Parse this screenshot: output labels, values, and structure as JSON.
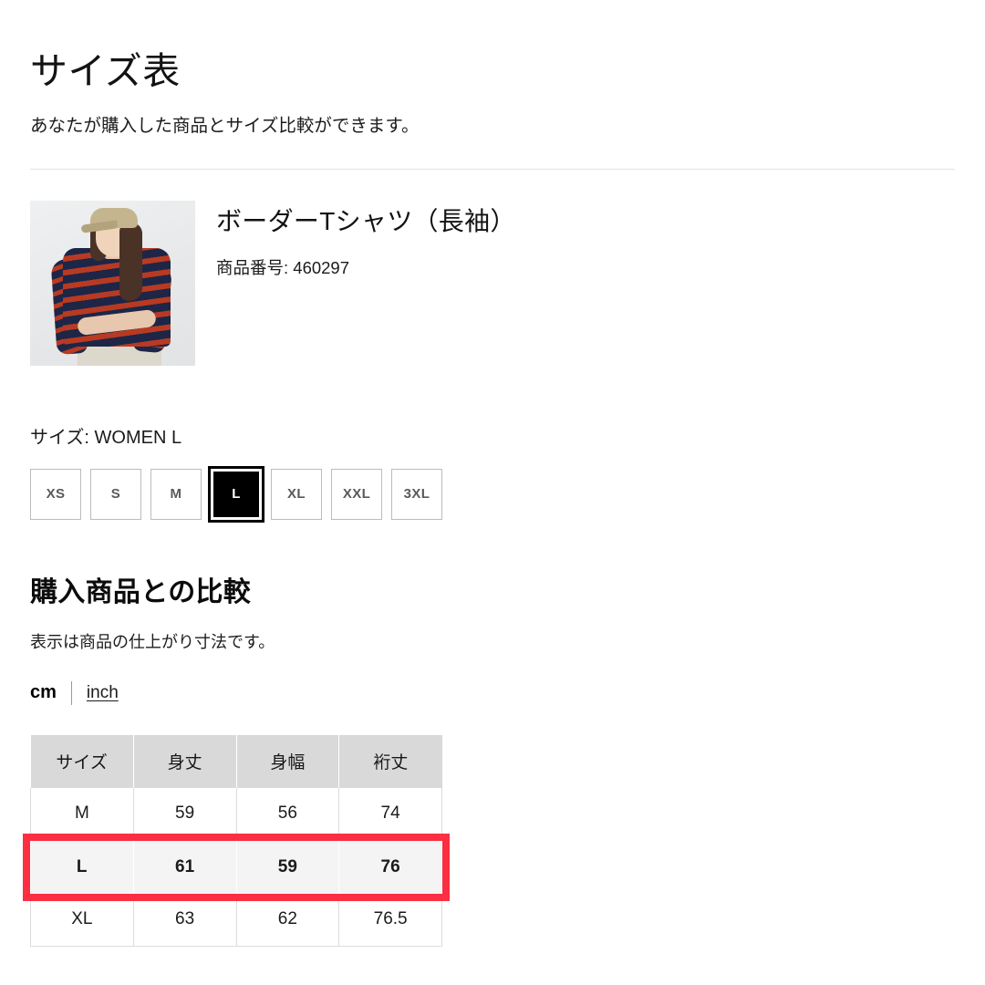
{
  "header": {
    "title": "サイズ表",
    "subtitle": "あなたが購入した商品とサイズ比較ができます。"
  },
  "product": {
    "image_alt": "striped-long-sleeve-tee-model-photo",
    "name": "ボーダーTシャツ（長袖）",
    "code_label": "商品番号: 460297"
  },
  "size_selector": {
    "label": "サイズ: WOMEN L",
    "selected": "L",
    "options": [
      {
        "label": "XS",
        "selected": false
      },
      {
        "label": "S",
        "selected": false
      },
      {
        "label": "M",
        "selected": false
      },
      {
        "label": "L",
        "selected": true
      },
      {
        "label": "XL",
        "selected": false
      },
      {
        "label": "XXL",
        "selected": false
      },
      {
        "label": "3XL",
        "selected": false
      }
    ]
  },
  "comparison": {
    "title": "購入商品との比較",
    "note": "表示は商品の仕上がり寸法です。",
    "units": {
      "active": "cm",
      "cm_label": "cm",
      "inch_label": "inch"
    }
  },
  "table": {
    "columns": [
      "サイズ",
      "身丈",
      "身幅",
      "裄丈"
    ],
    "rows": [
      {
        "size": "M",
        "values": [
          "59",
          "56",
          "74"
        ],
        "highlighted": false
      },
      {
        "size": "L",
        "values": [
          "61",
          "59",
          "76"
        ],
        "highlighted": true
      },
      {
        "size": "XL",
        "values": [
          "63",
          "62",
          "76.5"
        ],
        "highlighted": false
      }
    ],
    "highlight_color": "#fb2e42",
    "header_bg": "#d9d9d9",
    "highlight_row_bg": "#f4f4f4"
  }
}
